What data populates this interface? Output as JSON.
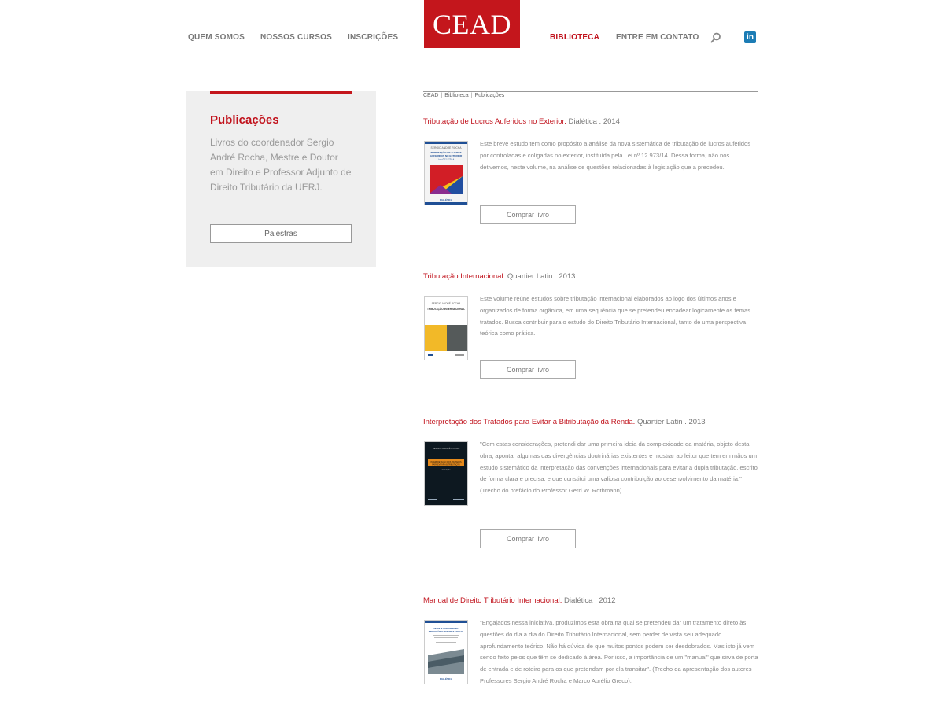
{
  "header": {
    "logo": "CEAD",
    "nav": [
      "QUEM SOMOS",
      "NOSSOS CURSOS",
      "INSCRIÇÕES"
    ],
    "nav_right": [
      "BIBLIOTECA",
      "ENTRE EM CONTATO"
    ],
    "linkedin": "in",
    "active_item": "BIBLIOTECA",
    "accent_color": "#c4161c"
  },
  "sidebar": {
    "title": "Publicações",
    "description": "Livros do coordenador Sergio André Rocha, Mestre e Doutor em Direito e Professor Adjunto de Direito Tributário da UERJ.",
    "button": "Palestras"
  },
  "breadcrumb": [
    "CEAD",
    "Biblioteca",
    "Publicações"
  ],
  "publications": [
    {
      "title": "Tributação de Lucros Auferidos no Exterior.",
      "meta": " Dialética . 2014",
      "description": "Este breve estudo tem como propósito a análise da nova sistemática de tributação de lucros auferidos por controladas e coligadas no exterior, instituída pela Lei nº 12.973/14. Dessa forma, não nos detivemos, neste volume, na análise de questões relacionadas à legislação que a precedeu.",
      "button": "Comprar livro",
      "cover": {
        "author": "SERGIO ANDRÉ ROCHA",
        "title": "TRIBUTAÇÃO DE LUCROS AUFERIDOS NO EXTERIOR",
        "subtitle": "Lei nº 12.973/14",
        "publisher": "DIALÉTICA"
      }
    },
    {
      "title": "Tributação Internacional.",
      "meta": " Quartier Latin . 2013",
      "description": "Este volume reúne estudos sobre tributação internacional elaborados ao logo dos últimos anos e organizados de forma orgânica, em uma sequência que se pretendeu encadear logicamente os temas tratados. Busca contribuir para o estudo do Direito Tributário Internacional, tanto de uma perspectiva teórica como prática.",
      "button": "Comprar livro",
      "cover": {
        "author": "SERGIO ANDRÉ ROCHA",
        "title": "TRIBUTAÇÃO INTERNACIONAL"
      }
    },
    {
      "title": "Interpretação dos Tratados para Evitar a Bitributação da Renda.",
      "meta": " Quartier Latin . 2013",
      "description": "\"Com estas considerações, pretendi dar uma primeira ideia da complexidade da matéria, objeto desta obra, apontar algumas das divergências doutrinárias existentes e mostrar ao leitor que tem em mãos um estudo sistemático da interpretação das convenções internacionais para evitar a dupla tributação, escrito de forma clara e precisa, e que constitui uma valiosa contribuição ao desenvolvimento da matéria.\" (Trecho do prefácio do Professor Gerd W. Rothmann).",
      "button": "Comprar livro",
      "cover": {
        "author": "SERGIO ANDRÉ ROCHA",
        "title": "INTERPRETAÇÃO DOS TRATADOS PARA EVITAR A BITRIBUTAÇÃO DA RENDA",
        "edition": "2ª Edição"
      }
    },
    {
      "title": "Manual de Direito Tributário Internacional.",
      "meta": " Dialética . 2012",
      "description": "\"Engajados nessa iniciativa, produzimos esta obra na qual se pretendeu dar um tratamento direto às questões do dia a dia do Direito Tributário Internacional, sem perder de vista seu adequado aprofundamento teórico. Não há dúvida de que muitos pontos podem ser desdobrados. Mas isto já vem sendo feito pelos que têm se dedicado à área. Por isso, a importância de um \"manual\" que sirva de porta de entrada e de roteiro para os que pretendam por ela transitar\". (Trecho da apresentação dos autores Professores Sergio André Rocha e Marco Aurélio Greco).",
      "cover": {
        "title": "MANUAL DE DIREITO TRIBUTÁRIO INTERNACIONAL",
        "publisher": "DIALÉTICA"
      }
    }
  ]
}
